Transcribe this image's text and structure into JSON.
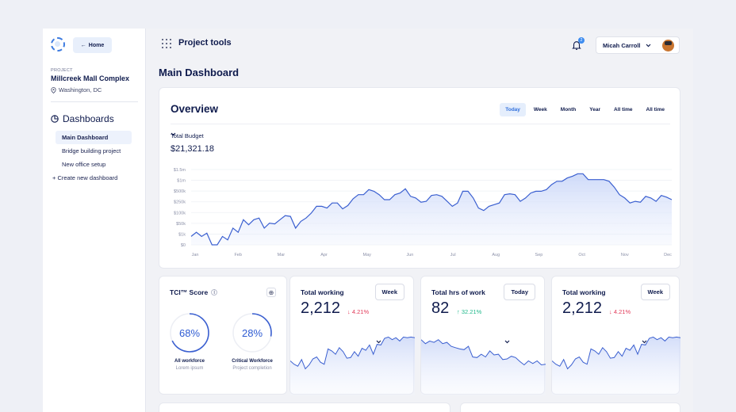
{
  "sidebar": {
    "home_label": "Home",
    "project_label": "PROJECT",
    "project_name": "Millcreek Mall Complex",
    "location": "Washington, DC",
    "section_title": "Dashboards",
    "items": [
      {
        "label": "Main Dashboard"
      },
      {
        "label": "Bridge building project"
      },
      {
        "label": "New office setup"
      }
    ],
    "create_label": "Create new dashboard"
  },
  "topbar": {
    "title": "Project tools",
    "notification_count": "2",
    "user_name": "Micah Carroll"
  },
  "page_title": "Main Dashboard",
  "overview": {
    "title": "Overview",
    "ranges": [
      "Today",
      "Week",
      "Month",
      "Year",
      "All time",
      "All time"
    ],
    "active_range": "Today",
    "metric_label": "Total Budget",
    "metric_value": "$21,321.18",
    "accent": "#2f6fdc"
  },
  "chart_data": [
    {
      "type": "area",
      "title": "Overview",
      "yticks": [
        "$1.5m",
        "$1m",
        "$500k",
        "$250k",
        "$100k",
        "$50k",
        "$1k",
        "$0"
      ],
      "categories": [
        "Jan",
        "Feb",
        "Mar",
        "Apr",
        "May",
        "Jun",
        "Jul",
        "Aug",
        "Sep",
        "Oct",
        "Nov",
        "Dec"
      ],
      "series": [
        {
          "values": [
            1,
            1.5,
            1,
            1.4,
            0,
            0,
            1,
            0.6,
            2,
            1.5,
            3,
            2.4,
            3,
            3.2,
            2,
            2.6,
            2.5,
            3,
            3.5,
            3.4,
            2,
            2.8,
            3.2,
            3.8,
            4.6,
            4.6,
            4.4,
            5,
            5,
            4.3,
            4.7,
            5.5,
            6,
            6,
            6.6,
            6.4,
            6,
            5.4,
            5.4,
            6,
            6.2,
            6.7,
            5.8,
            5.6,
            5.1,
            5.2,
            5.9,
            6,
            5.8,
            5.2,
            4.6,
            5,
            6.4,
            6.4,
            5.6,
            4.4,
            4.1,
            4.6,
            4.8,
            5,
            6,
            6.1,
            6,
            5.2,
            5.6,
            6.2,
            6.4,
            6.4,
            6.6,
            7.2,
            7.6,
            7.6,
            8,
            8.2,
            8.5,
            8.5,
            7.8,
            7.8,
            7.8,
            7.8,
            7.6,
            6.9,
            6,
            5.6,
            5,
            5.2,
            5.1,
            5.8,
            5.6,
            5.2,
            5.9,
            5.7,
            5.4
          ]
        }
      ]
    },
    {
      "type": "area",
      "title": "Total working",
      "series": [
        {
          "values": [
            4,
            3.5,
            3.2,
            4.2,
            2.8,
            3.4,
            4.3,
            4.6,
            3.8,
            3.5,
            5.8,
            5.5,
            5,
            6,
            5.4,
            4.4,
            4.5,
            5.4,
            4.7,
            5.9,
            5.6,
            6.4,
            5,
            6.5,
            6.4,
            7.4,
            7.6,
            7.2,
            7.5,
            7,
            7.6,
            7.5,
            7.6,
            7.5
          ]
        }
      ]
    },
    {
      "type": "area",
      "title": "Total hrs of work",
      "series": [
        {
          "values": [
            7.2,
            6.6,
            7,
            6.8,
            7.2,
            6.6,
            6.8,
            6.2,
            6,
            5.8,
            5.7,
            6.2,
            4.6,
            4.5,
            5,
            4.6,
            5.5,
            4.9,
            5,
            4.2,
            4.3,
            4.7,
            4.5,
            3.9,
            3.4,
            4,
            3.6,
            4,
            3.4,
            3.5
          ]
        }
      ]
    },
    {
      "type": "area",
      "title": "Total working",
      "series": [
        {
          "values": [
            4,
            3.5,
            3.2,
            4.2,
            2.8,
            3.4,
            4.3,
            4.6,
            3.8,
            3.5,
            5.8,
            5.5,
            5,
            6,
            5.4,
            4.4,
            4.5,
            5.4,
            4.7,
            5.9,
            5.6,
            6.4,
            5,
            6.5,
            6.4,
            7.4,
            7.6,
            7.2,
            7.5,
            7,
            7.6,
            7.5,
            7.6,
            7.5
          ]
        }
      ]
    }
  ],
  "tci": {
    "title": "TCI™ Score",
    "rings": [
      {
        "value": "68%",
        "pct": 68,
        "label": "All workforce",
        "sub": "Lorem ipsum"
      },
      {
        "value": "28%",
        "pct": 28,
        "label": "Critical Workforce",
        "sub": "Project completion"
      }
    ]
  },
  "kpis": [
    {
      "title": "Total working",
      "value": "2,212",
      "change": "4.21%",
      "direction": "down",
      "period": "Week"
    },
    {
      "title": "Total hrs of work",
      "value": "82",
      "change": "32.21%",
      "direction": "up",
      "period": "Today"
    },
    {
      "title": "Total working",
      "value": "2,212",
      "change": "4.21%",
      "direction": "down",
      "period": "Week"
    }
  ],
  "colors": {
    "down": "#e23b5a",
    "up": "#1fb88b",
    "line": "#3a5fd0",
    "fill": "#dfe6fb"
  }
}
